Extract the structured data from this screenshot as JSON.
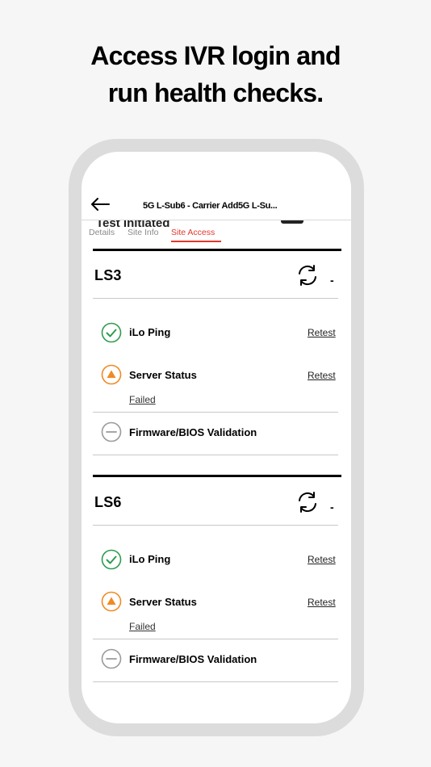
{
  "headline": {
    "line1": "Access IVR login and",
    "line2": "run health checks."
  },
  "header": {
    "title": "5G L-Sub6 - Carrier Add5G L-Su...",
    "peek_text": "Test Initiated"
  },
  "tabs": [
    {
      "label": "Details"
    },
    {
      "label": "Site Info"
    },
    {
      "label": "Site Access"
    }
  ],
  "cards": [
    {
      "title": "LS3",
      "dash": "-",
      "checks": [
        {
          "name": "iLo Ping",
          "retest": "Retest"
        },
        {
          "name": "Server Status",
          "retest": "Retest",
          "status": "Failed"
        },
        {
          "name": "Firmware/BIOS Validation"
        }
      ]
    },
    {
      "title": "LS6",
      "dash": "-",
      "checks": [
        {
          "name": "iLo Ping",
          "retest": "Retest"
        },
        {
          "name": "Server Status",
          "retest": "Retest",
          "status": "Failed"
        },
        {
          "name": "Firmware/BIOS Validation"
        }
      ]
    }
  ],
  "colors": {
    "accent": "#e3362c",
    "pass": "#2e9c4f",
    "warn": "#f08a24",
    "neutral": "#9a9a9a"
  }
}
